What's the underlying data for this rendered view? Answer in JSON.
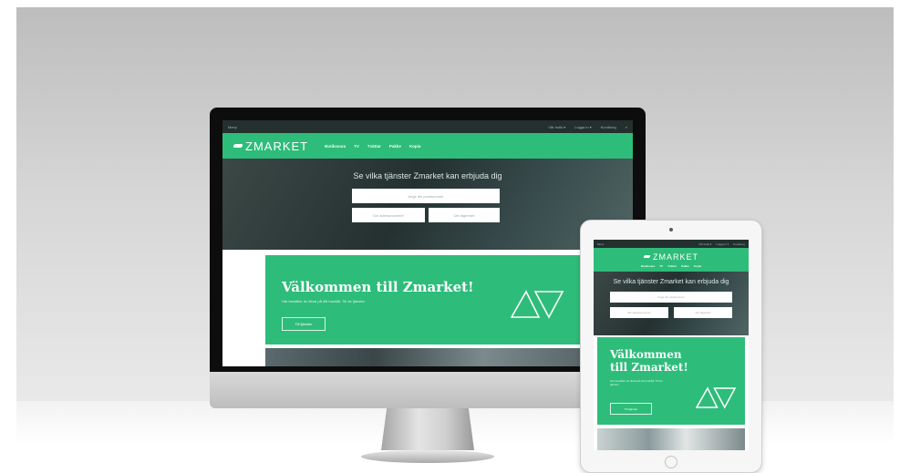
{
  "site": {
    "topbar_left": "Meny",
    "topbar_links": [
      "Vår butik ▾",
      "Logga in ▾",
      "Kundkorg"
    ],
    "logo_text": "ZMARKET",
    "nav_links": [
      "Butiksvara",
      "TV",
      "Tvättar",
      "Pakke",
      "Kopia"
    ],
    "hero_title": "Se vilka tjänster Zmarket kan erbjuda dig",
    "search_placeholder": "Ange din postnummer",
    "field_left": "Din adressnummer",
    "field_right": "Din lägenhet",
    "welcome_title": "Välkommen till Zmarket!",
    "welcome_title_line1": "Välkommen",
    "welcome_title_line2": "till Zmarket!",
    "welcome_text": "Här beställer du tillval på ditt hushåll. Till de tjänster",
    "welcome_button": "Till tjänster"
  },
  "colors": {
    "brand_green": "#2ebc7a",
    "dark_bar": "#23302e"
  },
  "icons": {
    "logo": "zmarket-logo-icon",
    "triangles": "triangle-emblem-icon"
  }
}
